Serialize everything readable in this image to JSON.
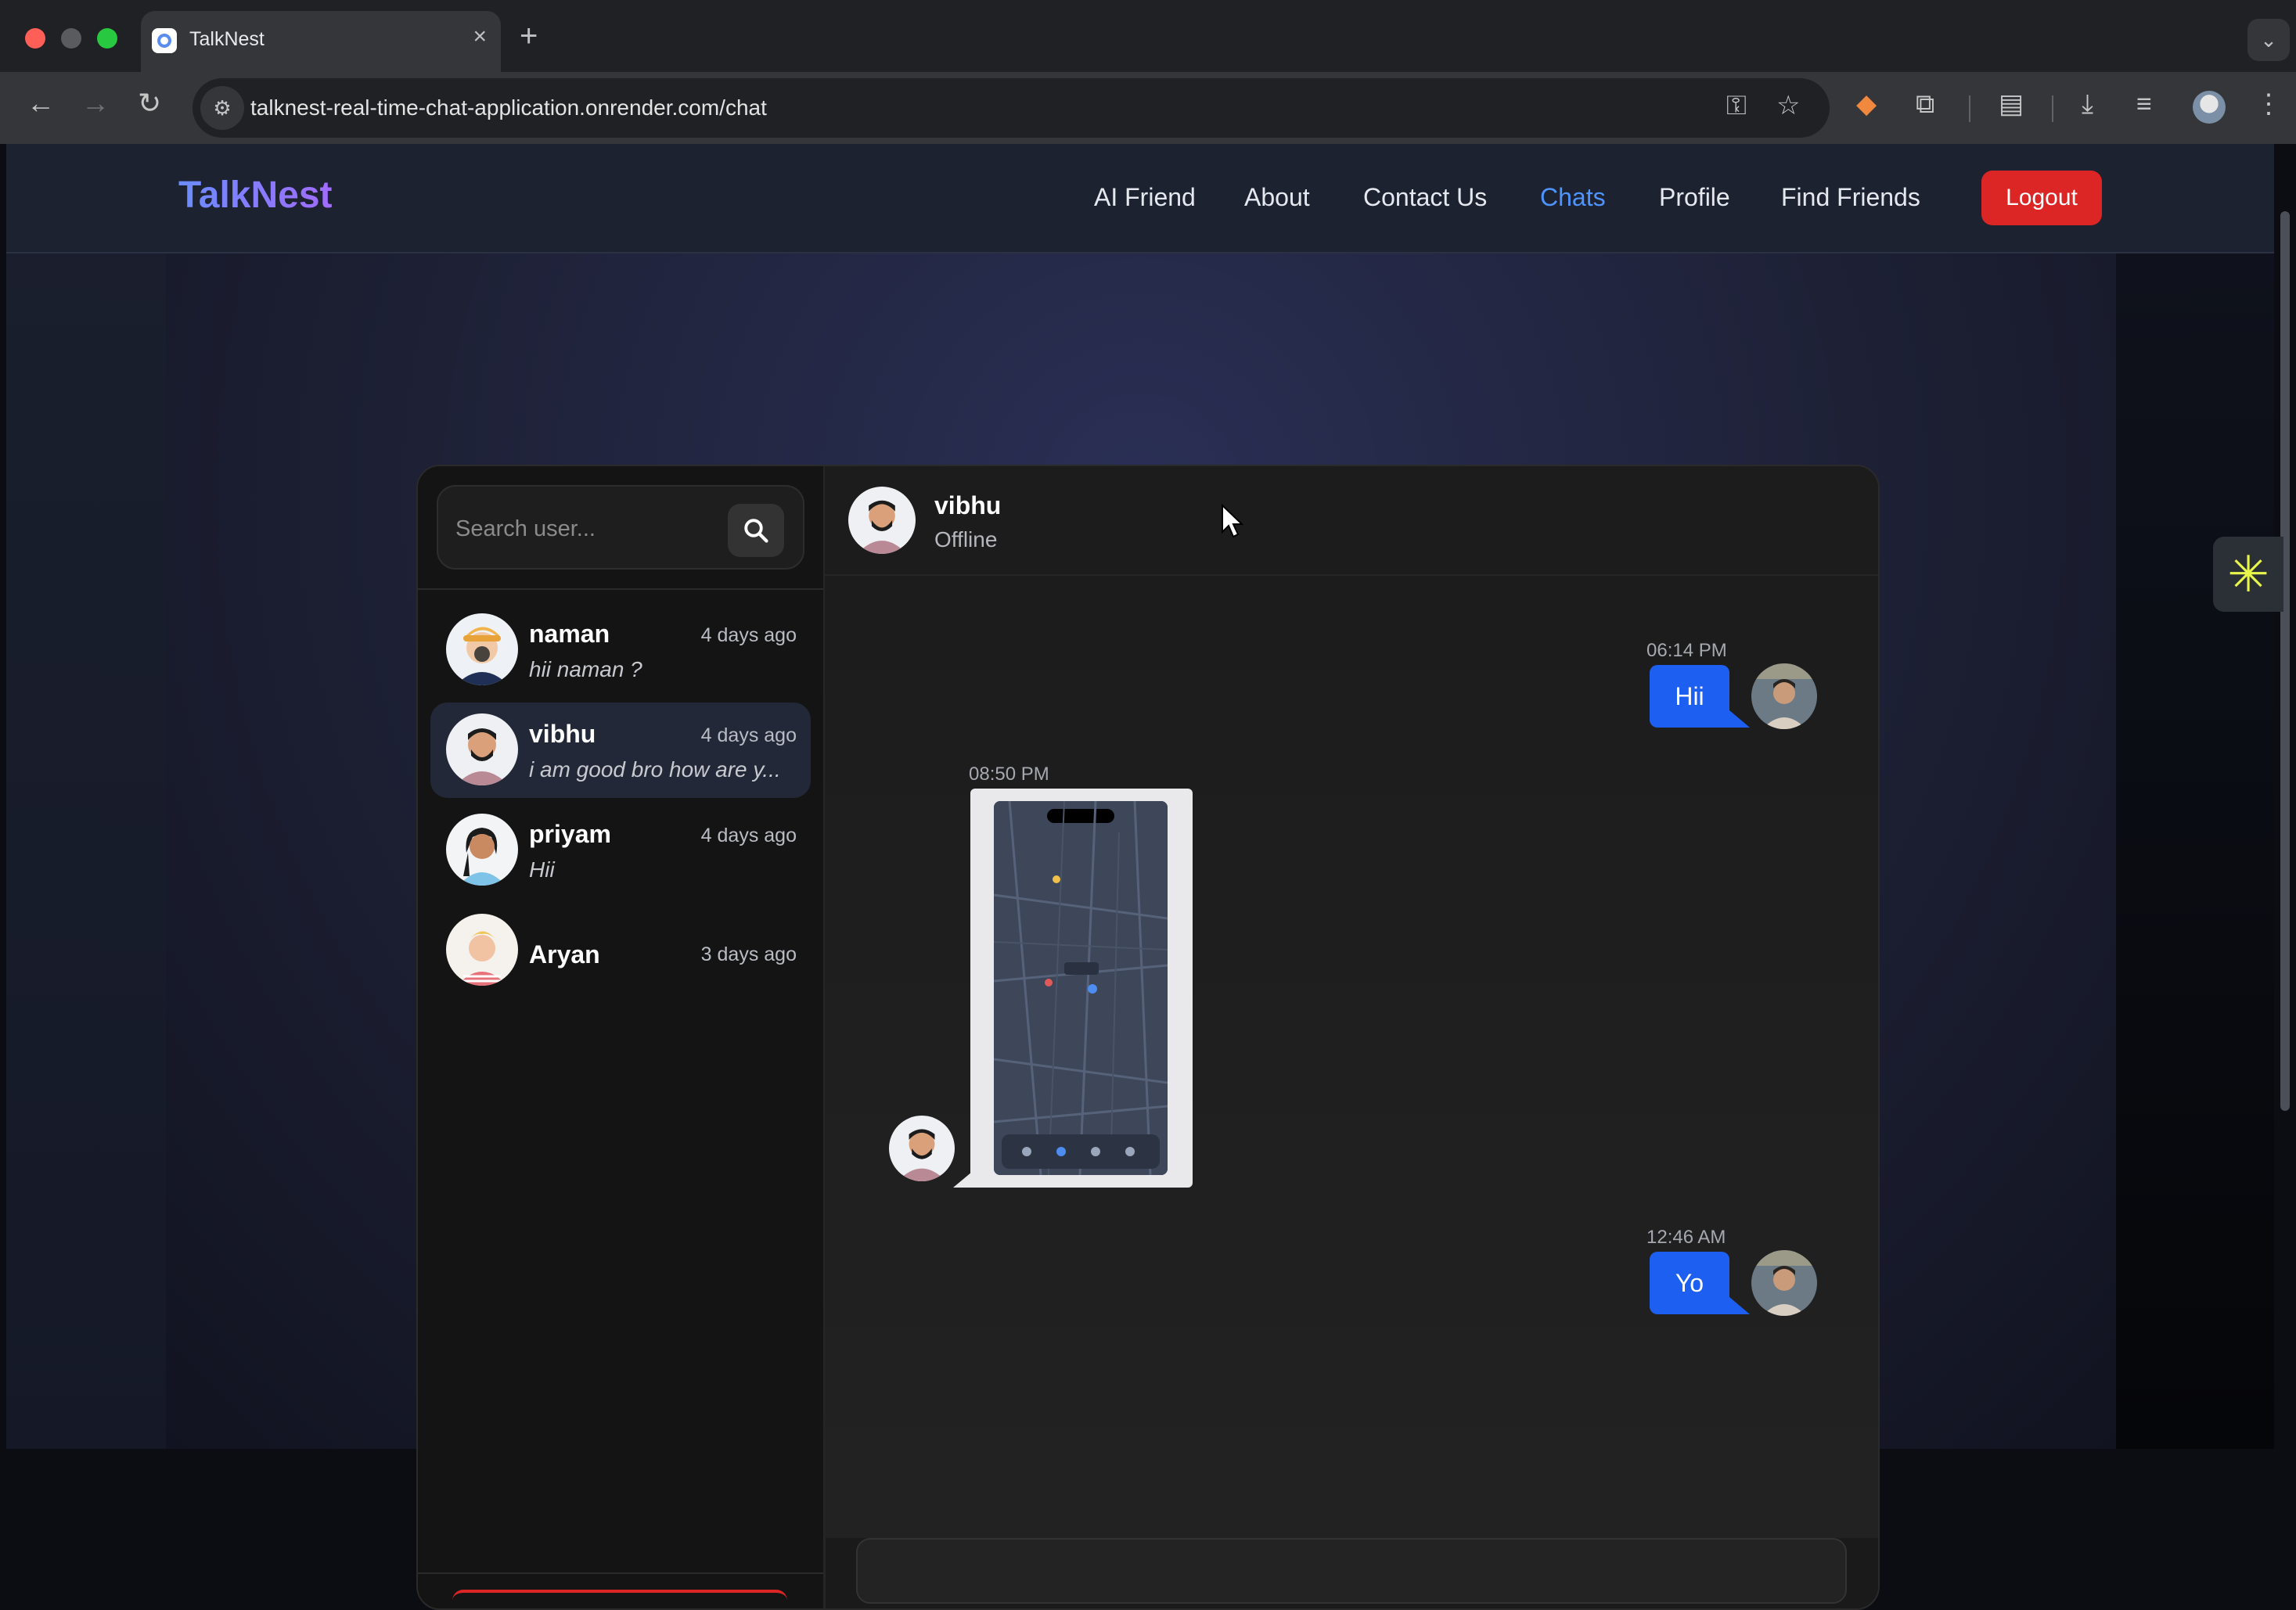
{
  "browser": {
    "tab_title": "TalkNest",
    "url": "talknest-real-time-chat-application.onrender.com/chat"
  },
  "navbar": {
    "brand": "TalkNest",
    "links": [
      "AI Friend",
      "About",
      "Contact Us",
      "Chats",
      "Profile",
      "Find Friends"
    ],
    "active_link": "Chats",
    "logout_label": "Logout"
  },
  "search": {
    "placeholder": "Search user..."
  },
  "conversations": [
    {
      "name": "naman",
      "time": "4 days ago",
      "preview": "hii naman ?",
      "active": false
    },
    {
      "name": "vibhu",
      "time": "4 days ago",
      "preview": "i am good bro how are y...",
      "active": true
    },
    {
      "name": "priyam",
      "time": "4 days ago",
      "preview": "Hii",
      "active": false
    },
    {
      "name": "Aryan",
      "time": "3 days ago",
      "preview": "",
      "active": false
    }
  ],
  "chat_header": {
    "name": "vibhu",
    "status": "Offline"
  },
  "messages": [
    {
      "direction": "out",
      "time": "06:14 PM",
      "text": "Hii"
    },
    {
      "direction": "in",
      "time": "08:50 PM",
      "type": "image",
      "alt": "map-screenshot"
    },
    {
      "direction": "out",
      "time": "12:46 AM",
      "text": "Yo"
    }
  ],
  "colors": {
    "accent_blue": "#1d5ff0",
    "active_link": "#4e94ff",
    "logout_red": "#dc2626",
    "brand_gradient": [
      "#6a8cff",
      "#a26bff"
    ]
  },
  "icons": {
    "search": "search-icon",
    "side_widget": "asterisk-widget-icon"
  }
}
